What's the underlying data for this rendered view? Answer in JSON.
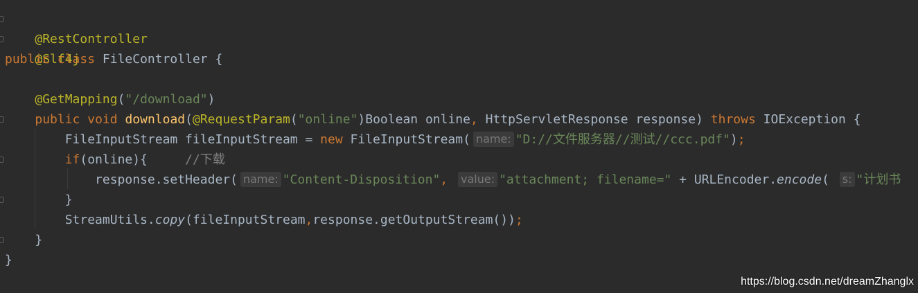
{
  "code": {
    "l1": {
      "ann": "@RestController"
    },
    "l2": {
      "ann": "@Slf4j"
    },
    "l3": {
      "kw_public": "public",
      "kw_class": "class",
      "class_name": " FileController {"
    },
    "l4": {
      "ann": "@GetMapping",
      "open": "(",
      "str": "\"/download\"",
      "close": ")"
    },
    "l5": {
      "kw_public": "public",
      "kw_void": "void",
      "fn": "download",
      "open": "(",
      "ann": "@RequestParam",
      "open2": "(",
      "str": "\"online\"",
      "rest": ")Boolean online",
      "comma": ",",
      "rest2": " HttpServletResponse response) ",
      "kw_throws": "throws",
      "rest3": " IOException {"
    },
    "l6": {
      "a": "FileInputStream fileInputStream = ",
      "kw_new": "new",
      "b": " FileInputStream(",
      "hint": "name:",
      "str": "\"D://文件服务器//测试//ccc.pdf\"",
      "close": ")",
      "semi": ";"
    },
    "l7": {
      "kw_if": "if",
      "a": "(online){     ",
      "comment": "//下载"
    },
    "l8": {
      "a": "response.setHeader(",
      "hint1": "name:",
      "str1": "\"Content-Disposition\"",
      "comma": ", ",
      "hint2": "value:",
      "str2": "\"attachment; filename=\"",
      "b": " + URLEncoder.",
      "fn_encode": "encode",
      "c": "( ",
      "hint3": "s:",
      "str3": "\"计划书"
    },
    "l9": {
      "text": "}"
    },
    "l10": {
      "a": "StreamUtils.",
      "fn_copy": "copy",
      "b": "(fileInputStream",
      "comma": ",",
      "c": "response.getOutputStream())",
      "semi": ";"
    },
    "l11": {
      "text": "}"
    },
    "l12": {
      "text": "}"
    }
  },
  "watermark": "https://blog.csdn.net/dreamZhanglx",
  "colors": {
    "background": "#2b2b2b",
    "text": "#a9b7c6",
    "annotation": "#bbb529",
    "keyword": "#cc7832",
    "string": "#6a8759",
    "method": "#ffc66d",
    "comment": "#808080"
  }
}
